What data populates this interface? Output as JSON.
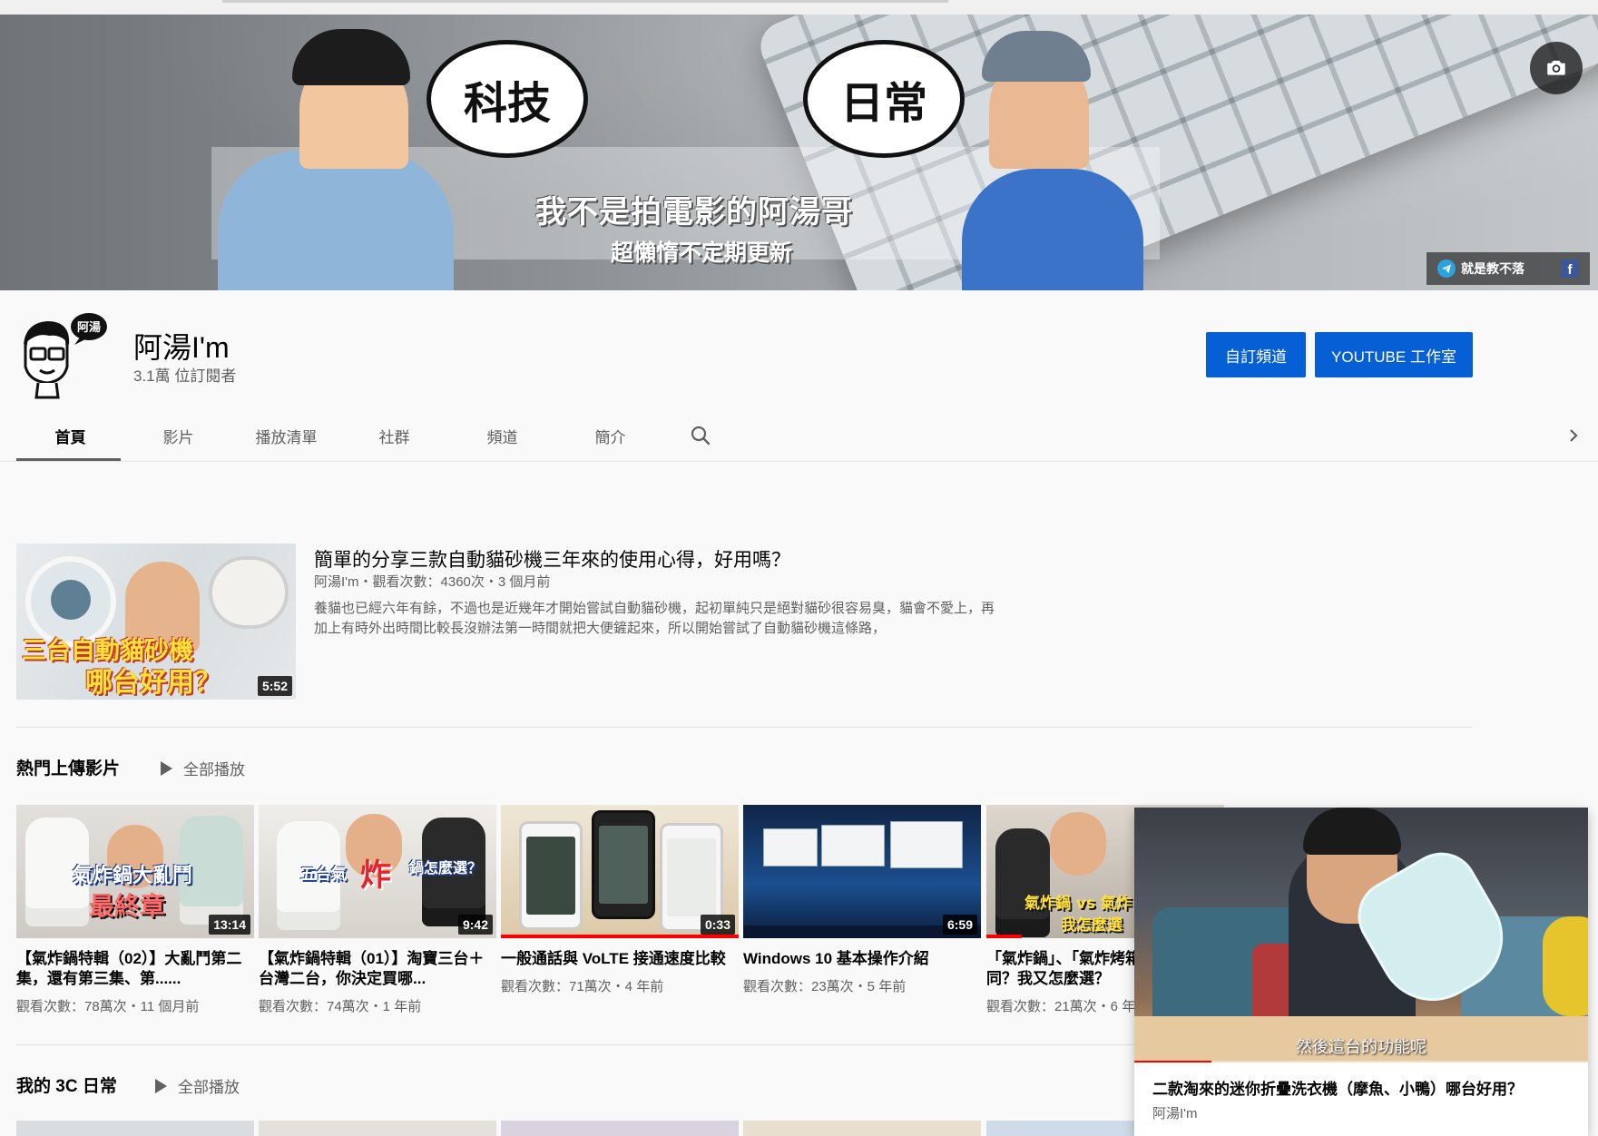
{
  "banner": {
    "bubble_left": "科技",
    "bubble_right": "日常",
    "title": "我不是拍電影的阿湯哥",
    "subtitle": "超懶惰不定期更新",
    "link_label": "就是教不落",
    "camera_icon": "camera-icon",
    "facebook_glyph": "f"
  },
  "channel": {
    "name": "阿湯I'm",
    "subscribers": "3.1萬 位訂閱者",
    "avatar_badge": "阿湯",
    "customize_label": "自訂頻道",
    "studio_label": "YOUTUBE 工作室"
  },
  "tabs": [
    {
      "label": "首頁",
      "active": true
    },
    {
      "label": "影片",
      "active": false
    },
    {
      "label": "播放清單",
      "active": false
    },
    {
      "label": "社群",
      "active": false
    },
    {
      "label": "頻道",
      "active": false
    },
    {
      "label": "簡介",
      "active": false
    }
  ],
  "featured": {
    "title": "簡單的分享三款自動貓砂機三年來的使用心得，好用嗎？",
    "meta": "阿湯I'm・觀看次數：4360次・3 個月前",
    "description": "養貓也已經六年有餘，不過也是近幾年才開始嘗試自動貓砂機，起初單純只是絕對貓砂很容易臭，貓會不愛上，再加上有時外出時間比較長沒辦法第一時間就把大便鏟起來，所以開始嘗試了自動貓砂機這條路，",
    "duration": "5:52",
    "thumb_line1": "三台自動貓砂機",
    "thumb_line2": "哪台好用？"
  },
  "shelf_popular": {
    "title": "熱門上傳影片",
    "play_all": "全部播放",
    "videos": [
      {
        "title": "【氣炸鍋特輯（02）】大亂鬥第二集，還有第三集、第......",
        "meta": "觀看次數：78萬次・11 個月前",
        "duration": "13:14",
        "caption1": "氣炸鍋大亂鬥",
        "caption2": "最終章",
        "progress": 0
      },
      {
        "title": "【氣炸鍋特輯（01）】淘寶三台＋台灣二台，你決定買哪...",
        "meta": "觀看次數：74萬次・1 年前",
        "duration": "9:42",
        "caption1": "五台氣",
        "caption2": "炸",
        "caption3": "鍋怎麼選？",
        "progress": 0
      },
      {
        "title": "一般通話與 VoLTE 接通速度比較",
        "meta": "觀看次數：71萬次・4 年前",
        "duration": "0:33",
        "progress": 1.0
      },
      {
        "title": "Windows 10 基本操作介紹",
        "meta": "觀看次數：23萬次・5 年前",
        "duration": "6:59",
        "progress": 0
      },
      {
        "title": "「氣炸鍋」、「氣炸烤箱」有什麼不同？我又怎麼選？",
        "meta": "觀看次數：21萬次・6 年前",
        "duration": "",
        "caption1": "氣炸鍋 vs 氣炸",
        "caption2": "我怎麼選",
        "progress": 0.15
      }
    ]
  },
  "shelf_3c": {
    "title": "我的 3C 日常",
    "play_all": "全部播放"
  },
  "mini_player": {
    "title": "二款淘來的迷你折疊洗衣機（摩魚、小鴨）哪台好用？",
    "channel": "阿湯I'm",
    "subtitle": "然後這台的功能呢",
    "progress": 0.17
  },
  "colors": {
    "accent_blue": "#065fd4",
    "progress_red": "#ff0000",
    "text_primary": "#030303",
    "text_secondary": "#606060"
  }
}
